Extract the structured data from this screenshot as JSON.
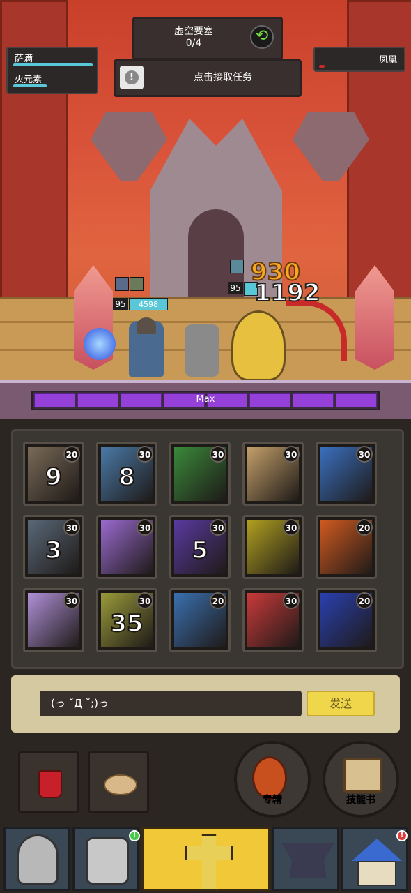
{
  "quest": {
    "title": "虚空要塞",
    "progress": "0/4",
    "task_label": "点击接取任务"
  },
  "player": {
    "name": "萨满",
    "element": "火元素",
    "hp_fraction": 0.95,
    "mp_fraction": 0.4
  },
  "enemy": {
    "name": "凤凰",
    "hp_fraction": 0.05
  },
  "battle": {
    "hero_level": "95",
    "hero_hp": "4598",
    "enemy_level": "95",
    "damage_1": "930",
    "damage_2": "1192",
    "max_label": "Max"
  },
  "skills": [
    {
      "name": "skill-hammer",
      "level": "20",
      "cooldown": "9",
      "color": "#7a6a58"
    },
    {
      "name": "skill-warrior",
      "level": "30",
      "cooldown": "8",
      "color": "#4a7aa8"
    },
    {
      "name": "skill-green-slash",
      "level": "30",
      "cooldown": "",
      "color": "#3a8a3a"
    },
    {
      "name": "skill-earth",
      "level": "30",
      "cooldown": "",
      "color": "#c4a06a"
    },
    {
      "name": "skill-frost",
      "level": "30",
      "cooldown": "",
      "color": "#3a70c0"
    },
    {
      "name": "skill-knight",
      "level": "30",
      "cooldown": "3",
      "color": "#5a6878"
    },
    {
      "name": "skill-frog",
      "level": "30",
      "cooldown": "",
      "color": "#9a6ad0"
    },
    {
      "name": "skill-shield",
      "level": "30",
      "cooldown": "5",
      "color": "#5a3aa0"
    },
    {
      "name": "skill-light",
      "level": "30",
      "cooldown": "",
      "color": "#b0a020"
    },
    {
      "name": "skill-fire-swirl",
      "level": "20",
      "cooldown": "",
      "color": "#d05a20"
    },
    {
      "name": "skill-spirit",
      "level": "30",
      "cooldown": "",
      "color": "#b090d8"
    },
    {
      "name": "skill-armor",
      "level": "30",
      "cooldown": "35",
      "color": "#9a9a3a"
    },
    {
      "name": "skill-dragon",
      "level": "20",
      "cooldown": "",
      "color": "#3a70b0"
    },
    {
      "name": "skill-demon-mask",
      "level": "30",
      "cooldown": "",
      "color": "#c83a3a"
    },
    {
      "name": "skill-lightning",
      "level": "20",
      "cooldown": "",
      "color": "#2a40b0"
    }
  ],
  "chat": {
    "input_value": "(っ ˘Д ˘;)っ",
    "send_label": "发送"
  },
  "actions": {
    "refine_label": "专精",
    "skillbook_label": "技能书"
  },
  "nav": {
    "badge": "!"
  },
  "colors": {
    "accent": "#f0d64a",
    "hp": "#58c8d8",
    "max_bar": "#9540d8"
  }
}
